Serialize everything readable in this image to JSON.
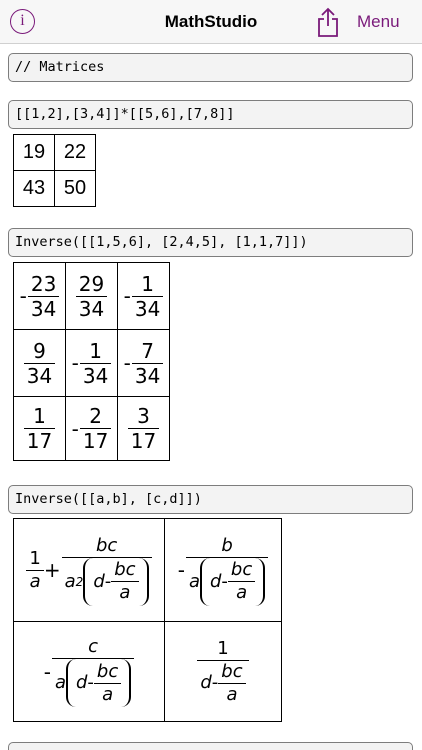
{
  "navbar": {
    "info_icon": "info-circle-icon",
    "title": "MathStudio",
    "share_icon": "share-icon",
    "menu_label": "Menu",
    "accent_color": "#7a1a7a"
  },
  "entries": [
    {
      "command": "// Matrices"
    },
    {
      "command": "[[1,2],[3,4]]*[[5,6],[7,8]]",
      "result": [
        [
          "19",
          "22"
        ],
        [
          "43",
          "50"
        ]
      ]
    },
    {
      "command": "Inverse([[1,5,6], [2,4,5], [1,1,7]])",
      "result": [
        [
          {
            "sign": "-",
            "num": "23",
            "den": "34"
          },
          {
            "sign": "",
            "num": "29",
            "den": "34"
          },
          {
            "sign": "-",
            "num": "1",
            "den": "34"
          }
        ],
        [
          {
            "sign": "",
            "num": "9",
            "den": "34"
          },
          {
            "sign": "-",
            "num": "1",
            "den": "34"
          },
          {
            "sign": "-",
            "num": "7",
            "den": "34"
          }
        ],
        [
          {
            "sign": "",
            "num": "1",
            "den": "17"
          },
          {
            "sign": "-",
            "num": "2",
            "den": "17"
          },
          {
            "sign": "",
            "num": "3",
            "den": "17"
          }
        ]
      ]
    },
    {
      "command": "Inverse([[a,b], [c,d]])",
      "result_symbols": {
        "one": "1",
        "a": "a",
        "b": "b",
        "c": "c",
        "d": "d",
        "bc": "bc",
        "plus": "+",
        "minus": "-",
        "sq": "2"
      }
    }
  ]
}
